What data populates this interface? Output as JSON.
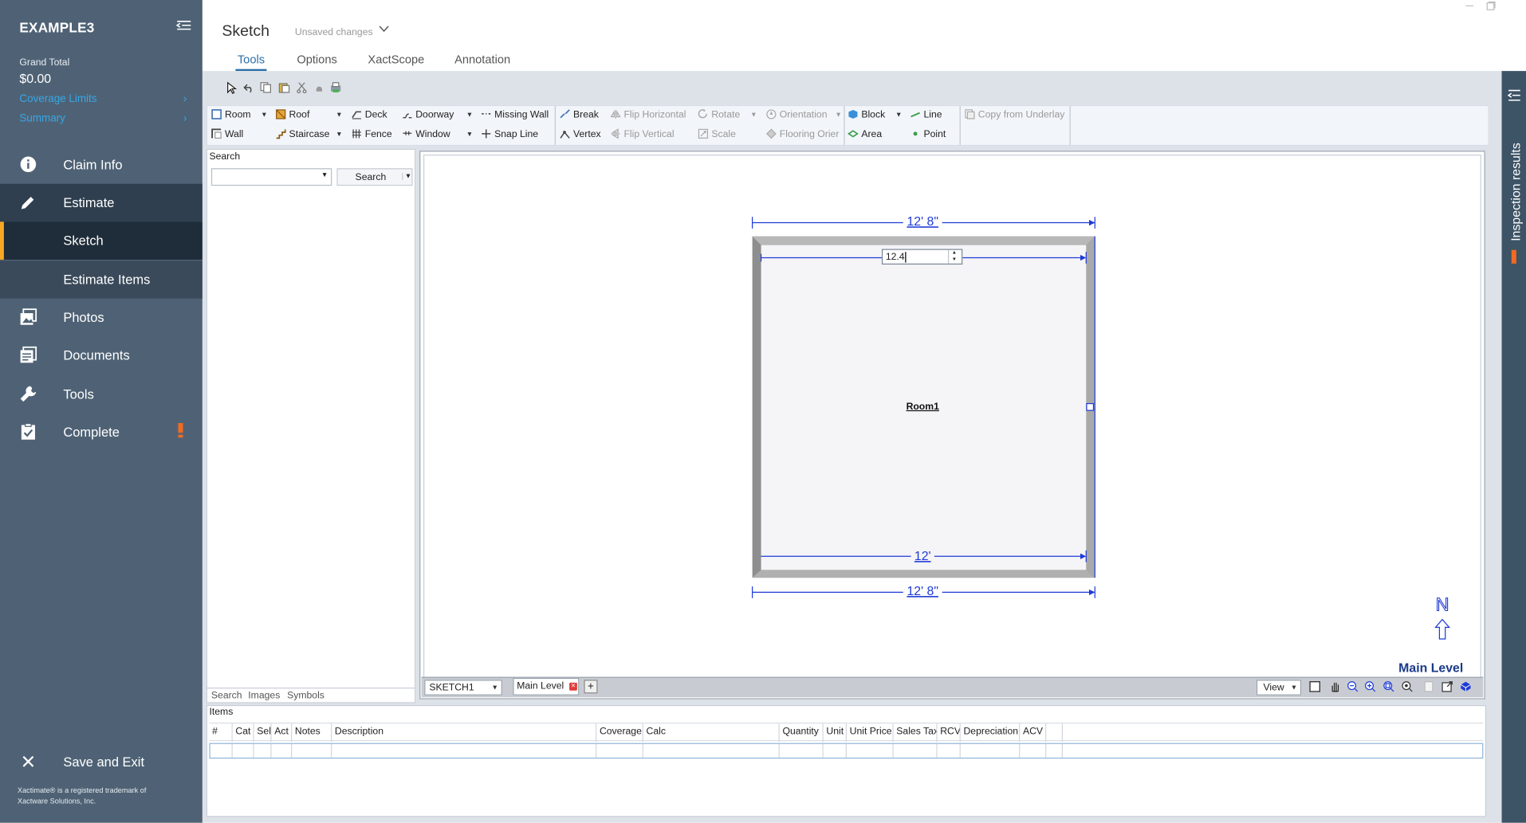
{
  "sidebar": {
    "title": "EXAMPLE3",
    "grand_total_label": "Grand Total",
    "grand_total_value": "$0.00",
    "links": [
      {
        "label": "Coverage Limits"
      },
      {
        "label": "Summary"
      }
    ],
    "nav": [
      {
        "label": "Claim Info",
        "icon": "info-icon"
      },
      {
        "label": "Estimate",
        "icon": "pencil-icon"
      },
      {
        "label": "Sketch",
        "sub": true,
        "selected": true
      },
      {
        "label": "Estimate Items",
        "sub": true
      },
      {
        "label": "Photos",
        "icon": "photos-icon"
      },
      {
        "label": "Documents",
        "icon": "documents-icon"
      },
      {
        "label": "Tools",
        "icon": "wrench-icon"
      },
      {
        "label": "Complete",
        "icon": "clipboard-check-icon",
        "warning": true
      }
    ],
    "save_exit": "Save and Exit",
    "footer_line1": "Xactimate® is a registered trademark of",
    "footer_line2": "Xactware Solutions, Inc."
  },
  "header": {
    "title": "Sketch",
    "status": "Unsaved changes",
    "tabs": [
      "Tools",
      "Options",
      "XactScope",
      "Annotation"
    ],
    "active_tab": "Tools"
  },
  "ribbon": {
    "row1": [
      "Room",
      "Roof",
      "Deck",
      "Doorway",
      "Missing Wall",
      "Break",
      "Flip Horizontal",
      "Rotate",
      "Orientation",
      "Block",
      "Line",
      "Copy from Underlay"
    ],
    "row2": [
      "Wall",
      "Staircase",
      "Fence",
      "Window",
      "Snap Line",
      "Vertex",
      "Flip Vertical",
      "Scale",
      "Flooring Orier",
      "Area",
      "Point"
    ]
  },
  "search_panel": {
    "heading": "Search",
    "input_value": "",
    "button": "Search",
    "tabs": [
      "Search",
      "Images",
      "Symbols"
    ]
  },
  "sketch": {
    "top_dimension": "12' 8\"",
    "bottom_dimension": "12' 8\"",
    "inner_bottom_dimension": "12'",
    "edit_value": "12.4",
    "room_label": "Room1",
    "north_label": "N",
    "level_label": "Main Level"
  },
  "canvas_bar": {
    "sketch_name": "SKETCH1",
    "level_tab": "Main Level",
    "add_level": "+",
    "view_label": "View"
  },
  "items": {
    "title": "Items",
    "columns": [
      "#",
      "Cat",
      "Sel",
      "Act",
      "Notes",
      "Description",
      "Coverage",
      "Calc",
      "Quantity",
      "Unit",
      "Unit Price",
      "Sales Tax",
      "RCV",
      "Depreciation",
      "ACV"
    ]
  },
  "right_panel": {
    "label": "Inspection results"
  },
  "colors": {
    "sidebar_bg": "#4f6275",
    "accent_link": "#35a7e8",
    "selected_marker": "#f7a823",
    "warning": "#f26a21",
    "sketch_blue": "#1f3bd6"
  }
}
